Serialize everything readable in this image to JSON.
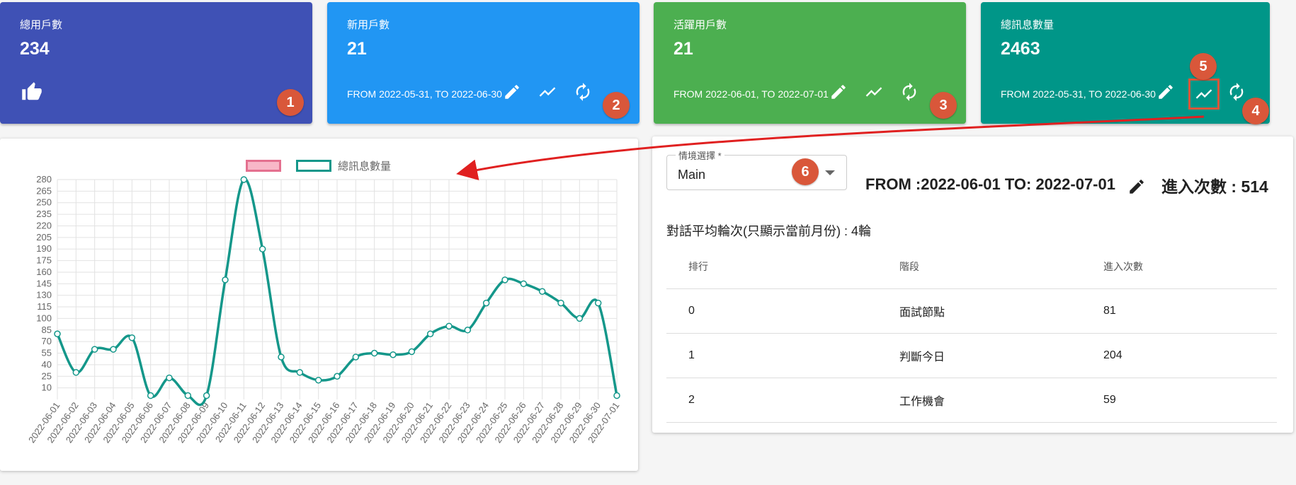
{
  "cards": [
    {
      "title": "總用戶數",
      "value": "234",
      "range": "",
      "color": "#3f51b5",
      "badge": "1"
    },
    {
      "title": "新用戶數",
      "value": "21",
      "range": "FROM 2022-05-31, TO 2022-06-30",
      "color": "#2196f3",
      "badge": "2"
    },
    {
      "title": "活躍用戶數",
      "value": "21",
      "range": "FROM 2022-06-01, TO 2022-07-01",
      "color": "#4caf50",
      "badge": "3"
    },
    {
      "title": "總訊息數量",
      "value": "2463",
      "range": "FROM 2022-05-31, TO 2022-06-30",
      "color": "#009688",
      "badge": "4"
    }
  ],
  "icons": {
    "thumbs_up": "thumb-up-icon",
    "edit": "pencil-icon",
    "trend": "trending-up-icon",
    "refresh": "refresh-icon"
  },
  "annotations": {
    "b5": "5",
    "b6": "6"
  },
  "chart_data": {
    "type": "line",
    "legend": [
      "",
      "總訊息數量"
    ],
    "x": [
      "2022-06-01",
      "2022-06-02",
      "2022-06-03",
      "2022-06-04",
      "2022-06-05",
      "2022-06-06",
      "2022-06-07",
      "2022-06-08",
      "2022-06-09",
      "2022-06-10",
      "2022-06-11",
      "2022-06-12",
      "2022-06-13",
      "2022-06-14",
      "2022-06-15",
      "2022-06-16",
      "2022-06-17",
      "2022-06-18",
      "2022-06-19",
      "2022-06-20",
      "2022-06-21",
      "2022-06-22",
      "2022-06-23",
      "2022-06-24",
      "2022-06-25",
      "2022-06-26",
      "2022-06-27",
      "2022-06-28",
      "2022-06-29",
      "2022-06-30",
      "2022-07-01"
    ],
    "series": [
      {
        "name": "總訊息數量",
        "values": [
          80,
          30,
          60,
          60,
          75,
          0,
          23,
          0,
          0,
          150,
          280,
          190,
          50,
          30,
          20,
          25,
          50,
          55,
          53,
          57,
          80,
          90,
          85,
          120,
          150,
          145,
          135,
          120,
          100,
          120,
          0
        ],
        "color": "#14978a"
      }
    ],
    "yticks": [
      10,
      25,
      40,
      55,
      70,
      85,
      100,
      115,
      130,
      145,
      160,
      175,
      190,
      205,
      220,
      235,
      250,
      265,
      280
    ],
    "ylim": [
      -5,
      280
    ],
    "grid": true,
    "legend_position": "top"
  },
  "scenario": {
    "label": "情境選擇 *",
    "value": "Main"
  },
  "date_range": "FROM :2022-06-01 TO: 2022-07-01",
  "entry_count": "進入次數 : 514",
  "avg_text": "對話平均輪次(只顯示當前月份) : 4輪",
  "table": {
    "headers": [
      "排行",
      "階段",
      "進入次數"
    ],
    "rows": [
      [
        "0",
        "面試節點",
        "81"
      ],
      [
        "1",
        "判斷今日",
        "204"
      ],
      [
        "2",
        "工作機會",
        "59"
      ]
    ]
  }
}
